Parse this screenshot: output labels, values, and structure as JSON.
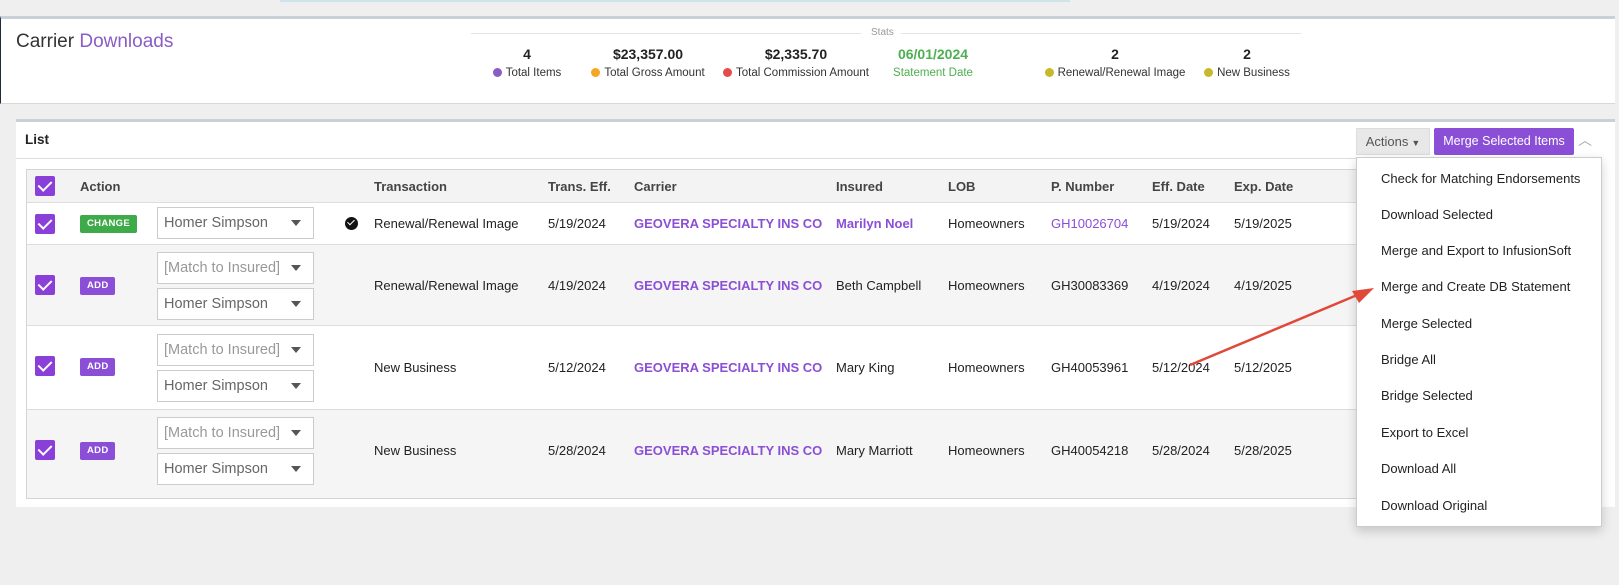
{
  "header": {
    "title_part1": "Carrier",
    "title_part2": "Downloads",
    "stats_label": "Stats",
    "stats": [
      {
        "value": "4",
        "label": "Total Items",
        "dot_color": "#8a5cc4"
      },
      {
        "value": "$23,357.00",
        "label": "Total Gross Amount",
        "dot_color": "#f5a623"
      },
      {
        "value": "$2,335.70",
        "label": "Total Commission Amount",
        "dot_color": "#e84a4a"
      },
      {
        "value": "06/01/2024",
        "label": "Statement Date",
        "dot_color": ""
      },
      {
        "value": "2",
        "label": "Renewal/Renewal Image",
        "dot_color": "#c8b82a"
      },
      {
        "value": "2",
        "label": "New Business",
        "dot_color": "#c8b82a"
      }
    ]
  },
  "list": {
    "title": "List",
    "actions_label": "Actions",
    "merge_label": "Merge Selected Items",
    "columns": [
      "Action",
      "Transaction",
      "Trans. Eff.",
      "Carrier",
      "Insured",
      "LOB",
      "P. Number",
      "Eff. Date",
      "Exp. Date"
    ],
    "rows": [
      {
        "badge": "CHANGE",
        "select1": "Homer Simpson",
        "select2": "",
        "transaction": "Renewal/Renewal Image",
        "trans_eff": "5/19/2024",
        "carrier": "GEOVERA SPECIALTY INS CO",
        "insured": "Marilyn Noel",
        "lob": "Homeowners",
        "p_number": "GH10026704",
        "eff_date": "5/19/2024",
        "exp_date": "5/19/2025"
      },
      {
        "badge": "ADD",
        "select1": "[Match to Insured]",
        "select2": "Homer Simpson",
        "transaction": "Renewal/Renewal Image",
        "trans_eff": "4/19/2024",
        "carrier": "GEOVERA SPECIALTY INS CO",
        "insured": "Beth Campbell",
        "lob": "Homeowners",
        "p_number": "GH30083369",
        "eff_date": "4/19/2024",
        "exp_date": "4/19/2025"
      },
      {
        "badge": "ADD",
        "select1": "[Match to Insured]",
        "select2": "Homer Simpson",
        "transaction": "New Business",
        "trans_eff": "5/12/2024",
        "carrier": "GEOVERA SPECIALTY INS CO",
        "insured": "Mary King",
        "lob": "Homeowners",
        "p_number": "GH40053961",
        "eff_date": "5/12/2024",
        "exp_date": "5/12/2025"
      },
      {
        "badge": "ADD",
        "select1": "[Match to Insured]",
        "select2": "Homer Simpson",
        "transaction": "New Business",
        "trans_eff": "5/28/2024",
        "carrier": "GEOVERA SPECIALTY INS CO",
        "insured": "Mary Marriott",
        "lob": "Homeowners",
        "p_number": "GH40054218",
        "eff_date": "5/28/2024",
        "exp_date": "5/28/2025"
      }
    ]
  },
  "dropdown": {
    "items": [
      "Check for Matching Endorsements",
      "Download Selected",
      "Merge and Export to InfusionSoft",
      "Merge and Create DB Statement",
      "Merge Selected",
      "Bridge All",
      "Bridge Selected",
      "Export to Excel",
      "Download All",
      "Download Original"
    ]
  },
  "colors": {
    "accent_purple": "#8a4fd6",
    "change_green": "#3faa4a",
    "statement_green": "#4caf50",
    "annotation_arrow": "#e0493a"
  }
}
